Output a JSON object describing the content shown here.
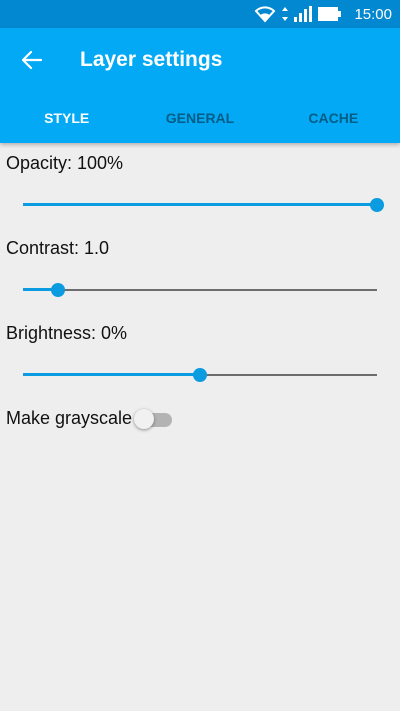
{
  "status_bar": {
    "time": "15:00",
    "icons": [
      "wifi-icon",
      "signal-icon",
      "battery-icon"
    ]
  },
  "app_bar": {
    "back_icon": "arrow-back-icon",
    "title": "Layer settings",
    "tabs": [
      {
        "label": "STYLE",
        "active": true
      },
      {
        "label": "GENERAL",
        "active": false
      },
      {
        "label": "CACHE",
        "active": false
      }
    ]
  },
  "settings": {
    "opacity": {
      "label": "Opacity: 100%",
      "value": 1.0
    },
    "contrast": {
      "label": "Contrast: 1.0",
      "value": 0.1
    },
    "brightness": {
      "label": "Brightness: 0%",
      "value": 0.5
    },
    "grayscale": {
      "label": "Make grayscale",
      "enabled": false
    }
  },
  "colors": {
    "status_bar": "#0288d1",
    "app_bar": "#03a9f4",
    "accent": "#0a9be0",
    "background": "#eeeeee"
  }
}
